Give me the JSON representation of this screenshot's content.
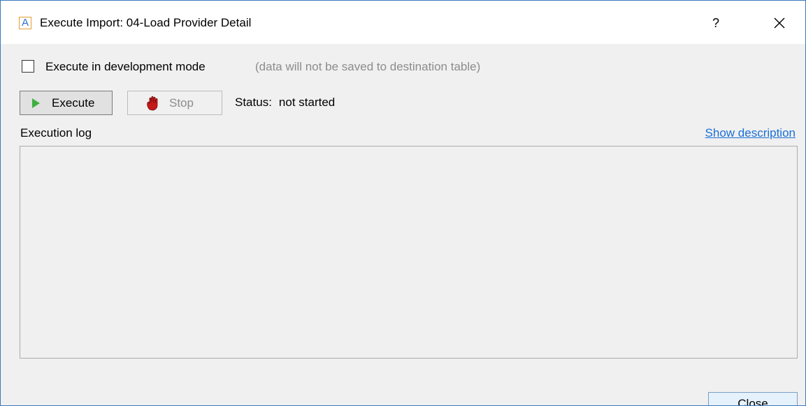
{
  "window": {
    "app_icon_letter": "A",
    "title": "Execute Import: 04-Load Provider Detail",
    "help_label": "?",
    "accent_color": "#3c78c0"
  },
  "options": {
    "dev_mode_checked": false,
    "dev_mode_label": "Execute in development mode",
    "dev_mode_hint": "(data will not be saved to destination table)"
  },
  "toolbar": {
    "execute_label": "Execute",
    "execute_icon": "play-icon",
    "stop_label": "Stop",
    "stop_icon": "hand-stop-icon",
    "status_label": "Status:",
    "status_value": "not started"
  },
  "log": {
    "label": "Execution log",
    "show_description_link": "Show description",
    "content": ""
  },
  "footer": {
    "close_label": "Close"
  }
}
